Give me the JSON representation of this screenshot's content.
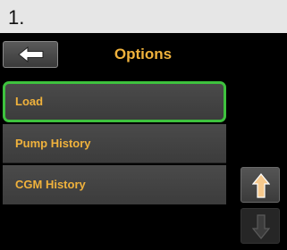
{
  "step": {
    "number": "1."
  },
  "header": {
    "title": "Options"
  },
  "menu": {
    "items": [
      {
        "label": "Load",
        "selected": true
      },
      {
        "label": "Pump History",
        "selected": false
      },
      {
        "label": "CGM History",
        "selected": false
      }
    ]
  },
  "icons": {
    "back": "left-arrow-icon",
    "scroll_up": "up-arrow-icon",
    "scroll_down": "down-arrow-icon"
  },
  "colors": {
    "accent_text": "#f0b23c",
    "selection": "#3ec23e",
    "scroll_up_arrow": "#f6c98d"
  }
}
